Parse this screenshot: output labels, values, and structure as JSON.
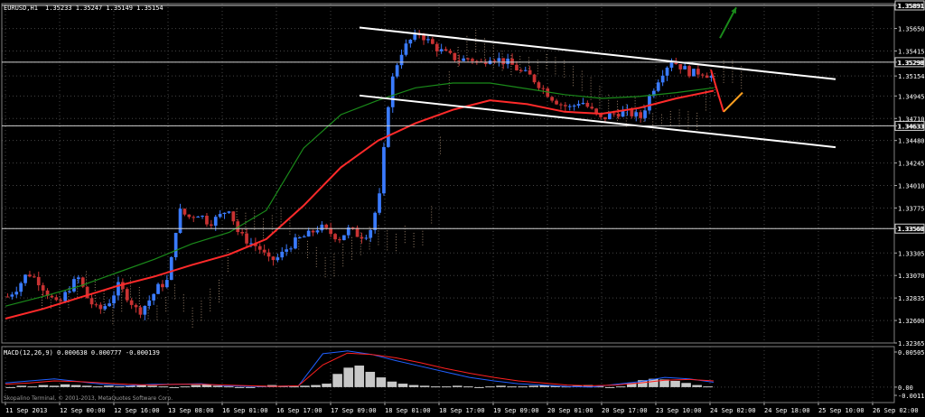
{
  "header": {
    "title": "EURUSD,H1",
    "ohlc": "1.35233 1.35247 1.35149 1.35154"
  },
  "macd": {
    "title": "MACD(12,26,9) 0.000638 0.000777 -0.000139",
    "levels": [
      "0.00505",
      "0.00",
      "-0.00118"
    ],
    "watermark": "Skopalino Terminal, © 2001-2013, MetaQuotes Software Corp."
  },
  "chart_data": {
    "type": "candlestick",
    "symbol": "EURUSD",
    "timeframe": "H1",
    "last_ohlc": {
      "open": 1.35233,
      "high": 1.35247,
      "low": 1.35149,
      "close": 1.35154
    },
    "price_axis_labels": [
      "1.35891",
      "1.35650",
      "1.35415",
      "1.35298",
      "1.35154",
      "1.34945",
      "1.34710",
      "1.34633",
      "1.34480",
      "1.34245",
      "1.34010",
      "1.33775",
      "1.33560",
      "1.33305",
      "1.33070",
      "1.32835",
      "1.32600",
      "1.32365"
    ],
    "horizontal_levels": [
      1.35891,
      1.35298,
      1.34633,
      1.3356
    ],
    "time_labels": [
      "11 Sep 2013",
      "12 Sep 00:00",
      "12 Sep 16:00",
      "13 Sep 08:00",
      "16 Sep 01:00",
      "16 Sep 17:00",
      "17 Sep 09:00",
      "18 Sep 01:00",
      "18 Sep 17:00",
      "19 Sep 09:00",
      "20 Sep 01:00",
      "20 Sep 17:00",
      "23 Sep 10:00",
      "24 Sep 02:00",
      "24 Sep 18:00",
      "25 Sep 10:00",
      "26 Sep 02:00"
    ],
    "price_path": [
      1.3285,
      1.3295,
      1.331,
      1.3302,
      1.3288,
      1.3275,
      1.3292,
      1.3305,
      1.3282,
      1.327,
      1.3278,
      1.3296,
      1.3284,
      1.3268,
      1.328,
      1.3295,
      1.3302,
      1.3375,
      1.3368,
      1.3372,
      1.3362,
      1.3368,
      1.3378,
      1.335,
      1.3342,
      1.3336,
      1.3322,
      1.3326,
      1.3338,
      1.3345,
      1.335,
      1.3358,
      1.3352,
      1.3346,
      1.3356,
      1.3348,
      1.3352,
      1.339,
      1.3502,
      1.3538,
      1.3552,
      1.356,
      1.355,
      1.3542,
      1.3536,
      1.3532,
      1.3534,
      1.3528,
      1.3536,
      1.3532,
      1.3528,
      1.352,
      1.3515,
      1.3505,
      1.3494,
      1.3486,
      1.3482,
      1.349,
      1.348,
      1.347,
      1.3475,
      1.3478,
      1.3476,
      1.3472,
      1.3498,
      1.3518,
      1.3532,
      1.3525,
      1.3518,
      1.352,
      1.3515
    ],
    "moving_averages": [
      {
        "color": "#ff2a2a",
        "values": [
          1.3262,
          1.3272,
          1.3284,
          1.3296,
          1.3306,
          1.3318,
          1.3329,
          1.3345,
          1.338,
          1.342,
          1.3448,
          1.3466,
          1.348,
          1.349,
          1.3486,
          1.3478,
          1.3476,
          1.3482,
          1.3492,
          1.35
        ]
      },
      {
        "color": "#1a8a1a",
        "values": [
          1.3275,
          1.3285,
          1.3296,
          1.331,
          1.3324,
          1.334,
          1.3352,
          1.3375,
          1.344,
          1.3475,
          1.349,
          1.3503,
          1.3508,
          1.3508,
          1.3502,
          1.3496,
          1.3492,
          1.3494,
          1.3498,
          1.3503
        ]
      }
    ],
    "channel": {
      "color": "#ffffff",
      "upper": [
        [
          398,
          1.3566
        ],
        [
          925,
          1.3512
        ]
      ],
      "lower": [
        [
          398,
          1.3495
        ],
        [
          925,
          1.3441
        ]
      ]
    },
    "projection": [
      {
        "color": "#ff2a2a",
        "points": [
          [
            787,
            1.3522
          ],
          [
            801,
            1.3478
          ]
        ]
      },
      {
        "color": "#ffa020",
        "points": [
          [
            801,
            1.3478
          ],
          [
            822,
            1.3498
          ]
        ]
      },
      {
        "color": "#1a8a1a",
        "points": [
          [
            797,
            1.3555
          ],
          [
            815,
            1.3587
          ]
        ]
      }
    ],
    "macd_histogram": [
      0,
      0.0002,
      0.0001,
      0.0003,
      0.0002,
      0.0004,
      0.0003,
      0.0002,
      0.0001,
      0.0002,
      0.0001,
      0.0002,
      0.0003,
      0.0002,
      0.0001,
      0,
      0.0001,
      0.0003,
      0.0004,
      0.0002,
      0.0001,
      0,
      -0.0001,
      0.0002,
      0.0003,
      0.0002,
      0.0001,
      0.0002,
      0.0003,
      0.0005,
      0.0019,
      0.0028,
      0.0031,
      0.0022,
      0.0014,
      0.0008,
      0.0005,
      0.0003,
      0.0002,
      0.0001,
      0.0001,
      0.0002,
      0.0001,
      0,
      0.0001,
      0.0002,
      0.0001,
      0.0001,
      0.0002,
      0.0003,
      0.0002,
      0.0001,
      0.0002,
      0.0003,
      0.0001,
      0,
      0.0001,
      0.0006,
      0.001,
      0.0012,
      0.0011,
      0.0009,
      0.0006,
      0.0003,
      0.0001
    ],
    "macd_lines": [
      {
        "color": "#2060ff",
        "values": [
          0.0006,
          0.0009,
          0.0012,
          0.0008,
          0.0004,
          0.0002,
          0.0004,
          0.0004,
          0.0005,
          0.0002,
          0.0001,
          0.0001,
          0.0002,
          0.0048,
          0.0052,
          0.0047,
          0.0038,
          0.003,
          0.0022,
          0.0014,
          0.0009,
          0.0005,
          0.0003,
          0.0001,
          0,
          0.0004,
          0.0008,
          0.0014,
          0.0012,
          0.0007
        ]
      },
      {
        "color": "#ff2020",
        "values": [
          0.0004,
          0.0006,
          0.0009,
          0.0008,
          0.0006,
          0.0004,
          0.0003,
          0.0004,
          0.0004,
          0.0003,
          0.0002,
          0.0001,
          0.0002,
          0.0032,
          0.0049,
          0.0047,
          0.0042,
          0.0035,
          0.0027,
          0.002,
          0.0014,
          0.0009,
          0.0006,
          0.0003,
          0.0002,
          0.0003,
          0.0006,
          0.001,
          0.0011,
          0.0009
        ]
      }
    ],
    "macd_range": [
      -0.00118,
      0.00505
    ]
  }
}
